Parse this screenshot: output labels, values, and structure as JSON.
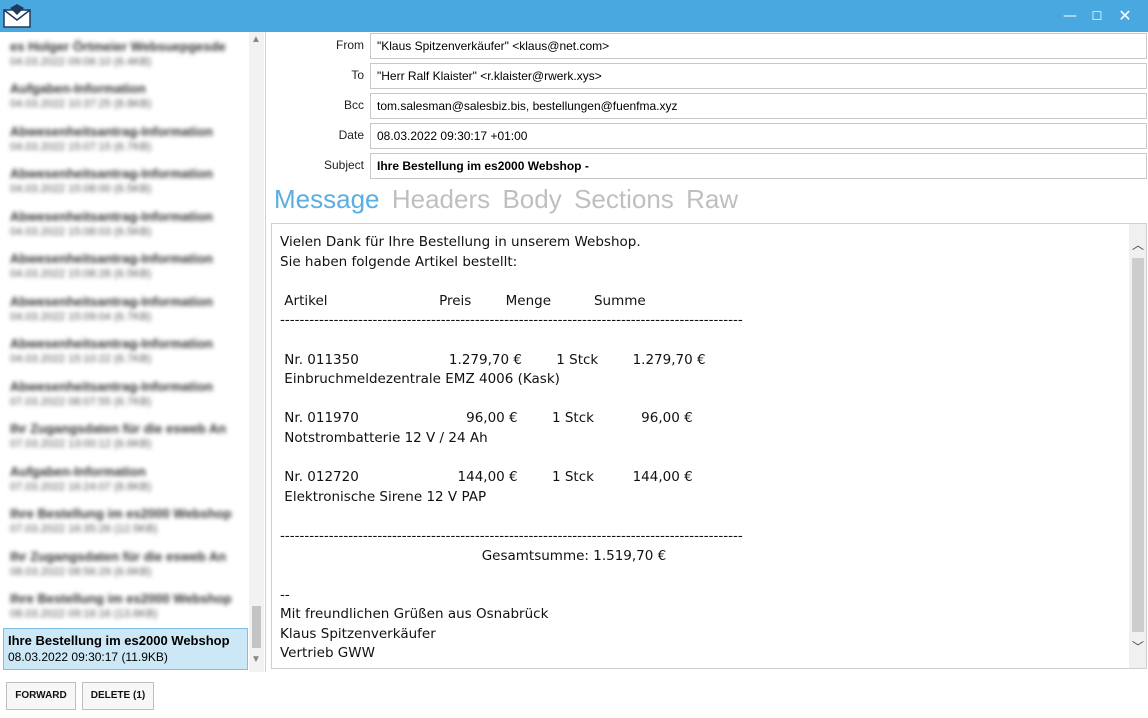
{
  "window": {
    "minimize_glyph": "—",
    "maximize_glyph": "☐",
    "close_glyph": "✕"
  },
  "message_list": {
    "items": [
      {
        "subject": "es Holger Örtmeier Websuepgesde",
        "meta": "04.03.2022 09:06:10 (6.4KB)"
      },
      {
        "subject": "Aufgaben-Information",
        "meta": "04.03.2022 10:37:25 (8.8KB)"
      },
      {
        "subject": "Abwesenheitsantrag-Information",
        "meta": "04.03.2022 15:07:15 (6.7KB)"
      },
      {
        "subject": "Abwesenheitsantrag-Information",
        "meta": "04.03.2022 15:08:00 (6.5KB)"
      },
      {
        "subject": "Abwesenheitsantrag-Information",
        "meta": "04.03.2022 15:08:03 (6.5KB)"
      },
      {
        "subject": "Abwesenheitsantrag-Information",
        "meta": "04.03.2022 15:08:28 (6.5KB)"
      },
      {
        "subject": "Abwesenheitsantrag-Information",
        "meta": "04.03.2022 15:09:04 (6.7KB)"
      },
      {
        "subject": "Abwesenheitsantrag-Information",
        "meta": "04.03.2022 15:10:22 (6.7KB)"
      },
      {
        "subject": "Abwesenheitsantrag-Information",
        "meta": "07.03.2022 08:07:55 (6.7KB)"
      },
      {
        "subject": "Ihr Zugangsdaten für die esweb An",
        "meta": "07.03.2022 13:00:12 (6.6KB)"
      },
      {
        "subject": "Aufgaben-Information",
        "meta": "07.03.2022 16:24:07 (8.8KB)"
      },
      {
        "subject": "Ihre Bestellung im es2000 Webshop",
        "meta": "07.03.2022 16:35:26 (12.5KB)"
      },
      {
        "subject": "Ihr Zugangsdaten für die esweb An",
        "meta": "08.03.2022 08:56:29 (6.6KB)"
      },
      {
        "subject": "Ihre Bestellung im es2000 Webshop",
        "meta": "08.03.2022 09:16:16 (13.6KB)"
      }
    ],
    "selected": {
      "subject": "Ihre Bestellung im es2000 Webshop",
      "meta": "08.03.2022 09:30:17 (11.9KB)"
    }
  },
  "buttons": {
    "forward": "FORWARD",
    "delete": "DELETE (1)"
  },
  "headers": {
    "from_label": "From",
    "from_value": "\"Klaus Spitzenverkäufer\" <klaus@net.com>",
    "to_label": "To",
    "to_value": "\"Herr Ralf Klaister\" <r.klaister@rwerk.xys>",
    "bcc_label": "Bcc",
    "bcc_value": "tom.salesman@salesbiz.bis, bestellungen@fuenfma.xyz",
    "date_label": "Date",
    "date_value": "08.03.2022 09:30:17 +01:00",
    "subject_label": "Subject",
    "subject_value": "Ihre Bestellung im es2000 Webshop -"
  },
  "tabs": [
    "Message",
    "Headers",
    "Body",
    "Sections",
    "Raw"
  ],
  "message_body": "Vielen Dank für Ihre Bestellung in unserem Webshop.\nSie haben folgende Artikel bestellt:\n\n Artikel                          Preis        Menge          Summe\n-----------------------------------------------------------------------------------------------\n\n Nr. 011350                     1.279,70 €        1 Stck        1.279,70 €\n Einbruchmeldezentrale EMZ 4006 (Kask)\n\n Nr. 011970                         96,00 €        1 Stck           96,00 €\n Notstrombatterie 12 V / 24 Ah\n\n Nr. 012720                       144,00 €        1 Stck         144,00 €\n Elektronische Sirene 12 V PAP\n\n-----------------------------------------------------------------------------------------------\n                                               Gesamtsumme: 1.519,70 €\n\n--\nMit freundlichen Grüßen aus Osnabrück\nKlaus Spitzenverkäufer\nVertrieb GWW",
  "colors": {
    "titlebar": "#4aa8e0",
    "active_tab": "#5aaee2",
    "inactive_tab": "#bfbfbf",
    "selection": "#cce8f7"
  }
}
